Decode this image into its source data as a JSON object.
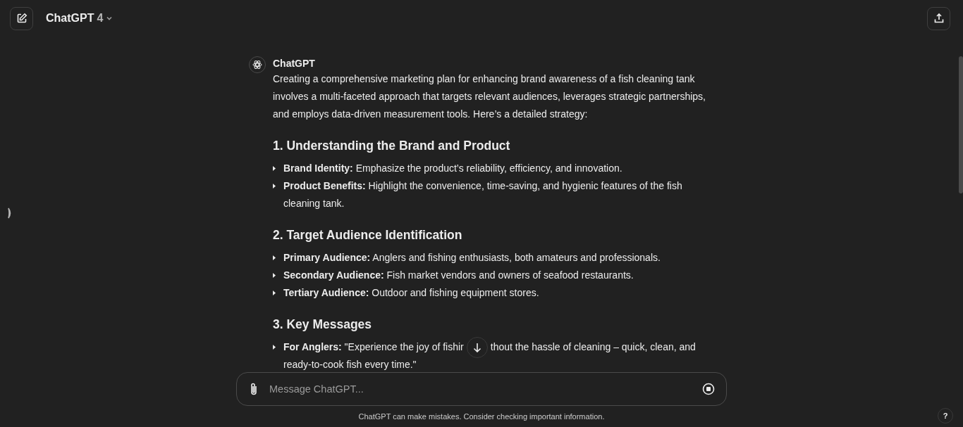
{
  "header": {
    "model": "ChatGPT",
    "version": "4"
  },
  "message": {
    "author": "ChatGPT",
    "intro": "Creating a comprehensive marketing plan for enhancing brand awareness of a fish cleaning tank involves a multi-faceted approach that targets relevant audiences, leverages strategic partnerships, and employs data-driven measurement tools. Here’s a detailed strategy:",
    "sections": [
      {
        "heading": "1. Understanding the Brand and Product",
        "items": [
          {
            "text": "**Brand Identity:** Emphasize the product’s reliability, efficiency, and innovation."
          },
          {
            "text": "**Product Benefits:** Highlight the convenience, time-saving, and hygienic features of the fish cleaning tank."
          }
        ]
      },
      {
        "heading": "2. Target Audience Identification",
        "items": [
          {
            "text": "**Primary Audience:** Anglers and fishing enthusiasts, both amateurs and professionals."
          },
          {
            "text": "**Secondary Audience:** Fish market vendors and owners of seafood restaurants."
          },
          {
            "text": "**Tertiary Audience:** Outdoor and fishing equipment stores."
          }
        ]
      },
      {
        "heading": "3. Key Messages",
        "items": [
          {
            "text": "**For Anglers:** \"Experience the joy of fishir",
            "text_after": "thout the hassle of cleaning – quick, clean, and",
            "continuation": "ready-to-cook fish every time.\""
          }
        ]
      }
    ]
  },
  "composer": {
    "placeholder": "Message ChatGPT..."
  },
  "footer": "ChatGPT can make mistakes. Consider checking important information.",
  "help": "?"
}
